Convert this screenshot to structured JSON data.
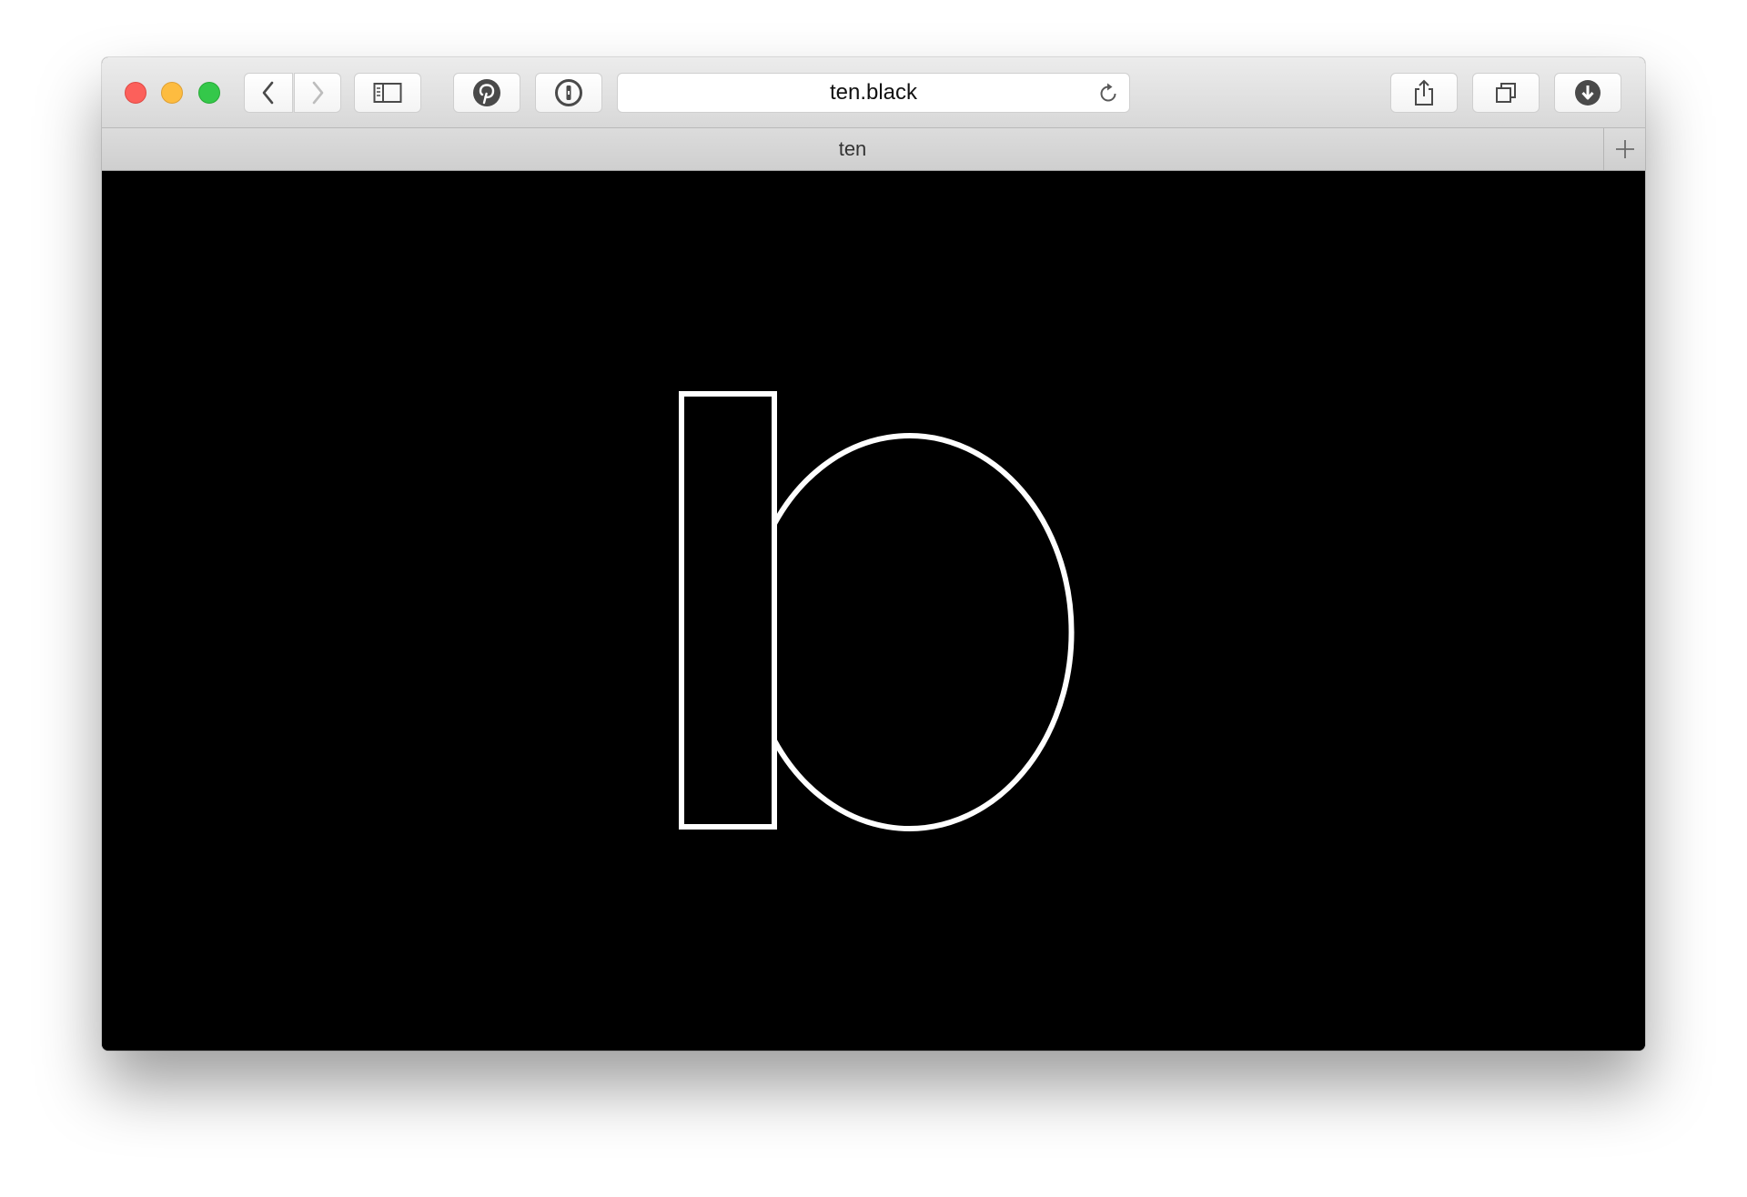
{
  "window": {
    "traffic_lights": {
      "close": "#fc605b",
      "minimize": "#fdbc40",
      "maximize": "#34c84a"
    }
  },
  "toolbar": {
    "back_icon": "chevron-left-icon",
    "forward_icon": "chevron-right-icon",
    "sidebar_icon": "sidebar-icon",
    "pinterest_icon": "pinterest-icon",
    "onepassword_icon": "1password-icon",
    "share_icon": "share-icon",
    "tabs_icon": "tabs-overview-icon",
    "download_icon": "download-icon"
  },
  "address_bar": {
    "url": "ten.black",
    "reload_icon": "reload-icon"
  },
  "tabs": [
    {
      "label": "ten",
      "active": true
    }
  ],
  "page": {
    "background": "#000000",
    "logo_color": "#ffffff",
    "logo_icon": "ten-black-logo"
  }
}
